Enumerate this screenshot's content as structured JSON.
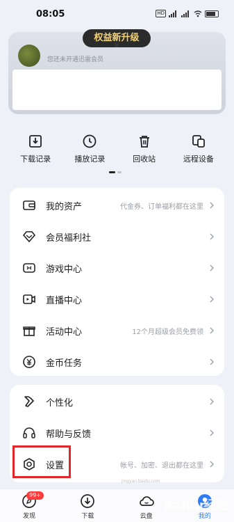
{
  "status_bar": {
    "time": "08:05",
    "network_badge": "HD",
    "battery": "100"
  },
  "vip_card": {
    "upgrade_label": "权益新升级",
    "subtitle": "您还未开通迅雷会员"
  },
  "quick_actions": [
    {
      "label": "下载记录",
      "icon": "download-record-icon"
    },
    {
      "label": "播放记录",
      "icon": "clock-icon"
    },
    {
      "label": "回收站",
      "icon": "trash-icon"
    },
    {
      "label": "远程设备",
      "icon": "devices-icon"
    }
  ],
  "menu_group_1": [
    {
      "label": "我的资产",
      "hint": "代金券、订单福利都在这里",
      "icon": "wallet-icon"
    },
    {
      "label": "会员福利社",
      "hint": "",
      "icon": "diamond-icon"
    },
    {
      "label": "游戏中心",
      "hint": "",
      "icon": "gamepad-icon"
    },
    {
      "label": "直播中心",
      "hint": "",
      "icon": "live-video-icon"
    },
    {
      "label": "活动中心",
      "hint": "12个月超级会员免费领",
      "icon": "gift-icon"
    },
    {
      "label": "金币任务",
      "hint": "",
      "icon": "coin-icon"
    }
  ],
  "menu_group_2": [
    {
      "label": "个性化",
      "hint": "",
      "icon": "personalize-icon"
    },
    {
      "label": "帮助与反馈",
      "hint": "",
      "icon": "headset-icon"
    },
    {
      "label": "设置",
      "hint": "帐号、加密、退出都在这里",
      "icon": "settings-icon"
    }
  ],
  "bottom_nav": [
    {
      "label": "发现",
      "icon": "discover-icon",
      "badge": "99+"
    },
    {
      "label": "下载",
      "icon": "download-icon"
    },
    {
      "label": "云盘",
      "icon": "cloud-icon"
    },
    {
      "label": "我的",
      "icon": "profile-icon",
      "active": true
    }
  ],
  "watermark": "Baidu经验",
  "watermark_url": "jingyan.baidu.com",
  "colors": {
    "accent": "#2f7cf6",
    "highlight": "#e0262a",
    "badge": "#ff3b3b",
    "vip_gold": "#f2d27a"
  }
}
